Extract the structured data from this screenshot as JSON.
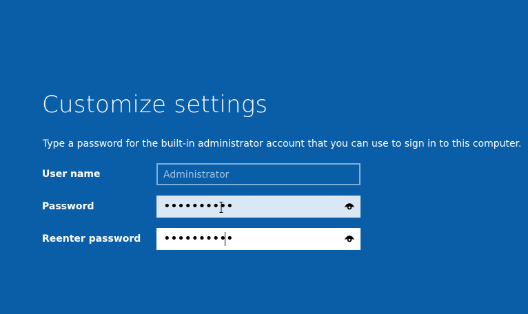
{
  "page": {
    "title": "Customize settings",
    "description": "Type a password for the built-in administrator account that you can use to sign in to this computer."
  },
  "fields": {
    "username": {
      "label": "User name",
      "value": "Administrator"
    },
    "password": {
      "label": "Password",
      "masked_value": "••••••••••"
    },
    "reenter_password": {
      "label": "Reenter password",
      "masked_value": "••••••••••"
    }
  },
  "icons": {
    "reveal": "eye-icon",
    "cursor": "ibeam-cursor-icon"
  },
  "colors": {
    "background": "#0a5ea8",
    "text": "#ffffff",
    "field_focus": "#ffffff",
    "field_hover": "#d9e8f4",
    "disabled_border": "#7fb0d9",
    "disabled_text": "#9fc4e5"
  }
}
